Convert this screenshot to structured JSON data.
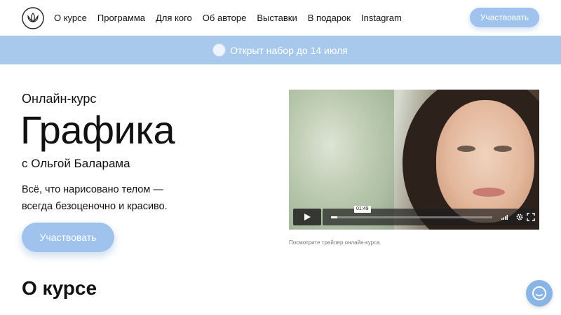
{
  "header": {
    "nav": [
      "О курсе",
      "Программа",
      "Для кого",
      "Об авторе",
      "Выставки",
      "В подарок",
      "Instagram"
    ],
    "cta_label": "Участвовать"
  },
  "banner": {
    "text": "Открыт набор до 14 июля"
  },
  "hero": {
    "kicker": "Онлайн-курс",
    "title": "Графика",
    "author": "с Ольгой Баларама",
    "description_line1": "Всё, что нарисовано телом —",
    "description_line2": "всегда безоценочно и красиво.",
    "cta_label": "Участвовать"
  },
  "video": {
    "time": "01:49",
    "progress_fraction": 0.04,
    "caption": "Посмотрите трейлер онлайн-курса"
  },
  "about": {
    "title": "О курсе"
  },
  "colors": {
    "accent": "#9fc3ec",
    "banner": "#a8c8ec",
    "chat": "#88b4e6"
  },
  "icons": {
    "logo": "lotus-icon",
    "banner": "circle-dot-icon",
    "play": "play-icon",
    "volume": "volume-icon",
    "settings": "gear-icon",
    "fullscreen": "fullscreen-icon",
    "chat": "chat-icon"
  }
}
